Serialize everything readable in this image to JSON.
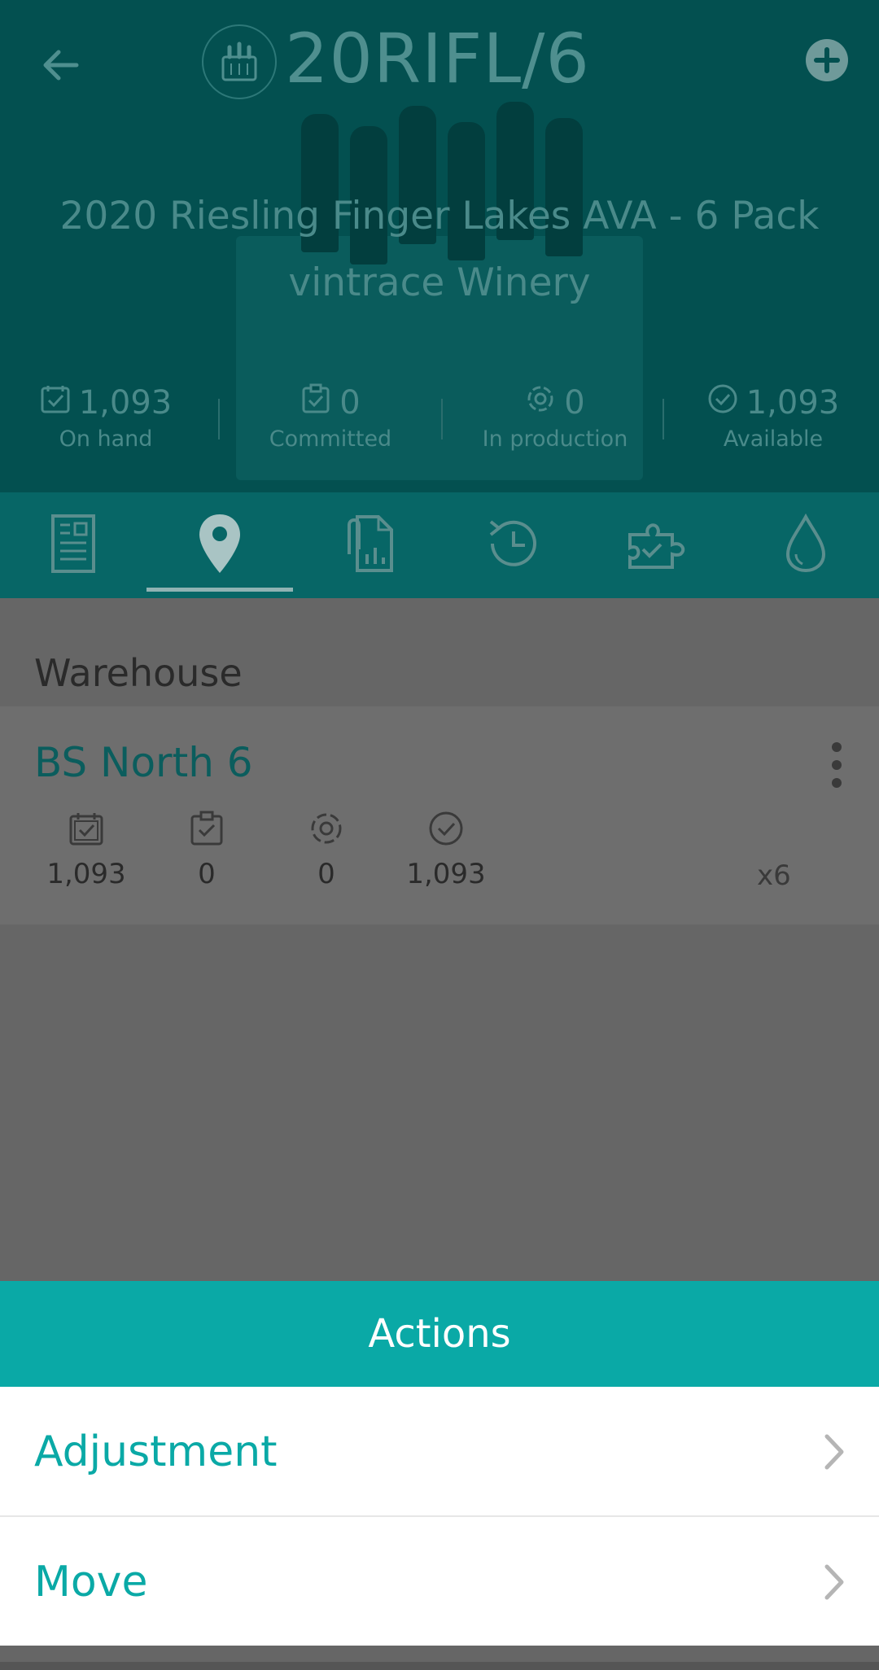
{
  "header": {
    "code": "20RIFL/6",
    "title": "2020 Riesling Finger Lakes AVA - 6 Pack",
    "winery": "vintrace Winery",
    "icons": {
      "back": "arrow-left-icon",
      "add": "plus-circle-icon",
      "badge": "bottles-icon"
    }
  },
  "stats": [
    {
      "value": "1,093",
      "label": "On hand",
      "icon": "calendar-check-icon"
    },
    {
      "value": "0",
      "label": "Committed",
      "icon": "clipboard-check-icon"
    },
    {
      "value": "0",
      "label": "In production",
      "icon": "gear-cycle-icon"
    },
    {
      "value": "1,093",
      "label": "Available",
      "icon": "check-circle-icon"
    }
  ],
  "tabs": [
    {
      "name": "details",
      "icon": "document-icon"
    },
    {
      "name": "location",
      "icon": "map-pin-icon",
      "active": true
    },
    {
      "name": "attachments",
      "icon": "paperclip-chart-icon"
    },
    {
      "name": "history",
      "icon": "history-icon"
    },
    {
      "name": "components",
      "icon": "puzzle-check-icon"
    },
    {
      "name": "composition",
      "icon": "drop-icon"
    }
  ],
  "section_title": "Warehouse",
  "location": {
    "name": "BS North 6",
    "values": [
      "1,093",
      "0",
      "0",
      "1,093"
    ],
    "pack": "x6"
  },
  "actions": {
    "title": "Actions",
    "items": [
      "Adjustment",
      "Move"
    ]
  },
  "colors": {
    "accent": "#0aa9a6",
    "header": "#035050",
    "overlay": "#666666"
  }
}
